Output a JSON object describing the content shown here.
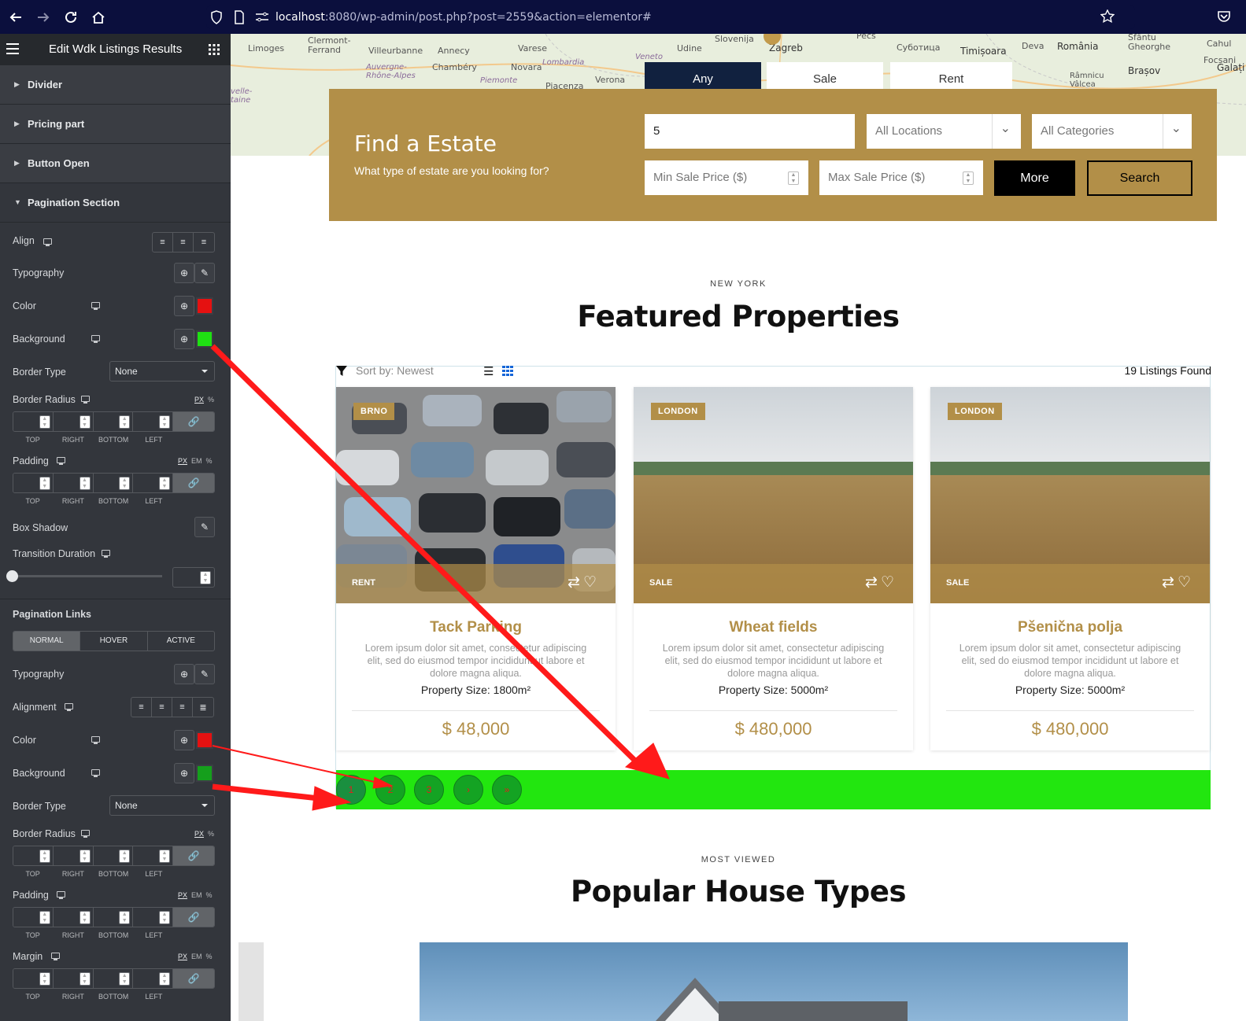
{
  "browser": {
    "url_host": "localhost",
    "url_rest": ":8080/wp-admin/post.php?post=2559&action=elementor#"
  },
  "sidebar": {
    "title": "Edit Wdk Listings Results",
    "sections": [
      "Divider",
      "Pricing part",
      "Button Open",
      "Pagination Section"
    ],
    "pagination_section": {
      "align": "Align",
      "typography": "Typography",
      "color": "Color",
      "color_value": "#e51111",
      "background": "Background",
      "background_value": "#1fe013",
      "border_type": "Border Type",
      "border_type_value": "None",
      "border_radius": "Border Radius",
      "padding": "Padding",
      "box_shadow": "Box Shadow",
      "transition_duration": "Transition Duration"
    },
    "dim_labels": [
      "TOP",
      "RIGHT",
      "BOTTOM",
      "LEFT"
    ],
    "units_px": "PX",
    "units_em": "EM",
    "units_pct": "%",
    "pagination_links": {
      "heading": "Pagination Links",
      "tabs": [
        "NORMAL",
        "HOVER",
        "ACTIVE"
      ],
      "typography": "Typography",
      "alignment": "Alignment",
      "color": "Color",
      "color_value": "#e51111",
      "background": "Background",
      "background_value": "#159f1c",
      "border_type": "Border Type",
      "border_type_value": "None",
      "border_radius": "Border Radius",
      "padding": "Padding",
      "margin": "Margin"
    }
  },
  "map_labels": [
    "Slovenija",
    "Zagreb",
    "Pecs",
    "Суботица",
    "Timișoara",
    "Deva",
    "România",
    "Sfântu Gheorghe",
    "Cahul",
    "Focșani",
    "Galați",
    "Brașov",
    "Râmnicu Vâlcea",
    "Limoges",
    "Clermont-Ferrand",
    "Villeurbanne",
    "Annecy",
    "Varese",
    "Udine",
    "Chambéry",
    "Auvergne-Rhône-Alpes",
    "Novara",
    "Lombardia",
    "Veneto",
    "Verona",
    "Piemonte",
    "Piacenza",
    "velle-taine"
  ],
  "search": {
    "tabs": [
      "Any",
      "Sale",
      "Rent"
    ],
    "heading": "Find a Estate",
    "subheading": "What type of estate are you looking for?",
    "keyword_value": "5",
    "locations_placeholder": "All Locations",
    "categories_placeholder": "All Categories",
    "min_price_placeholder": "Min Sale Price  ($)",
    "max_price_placeholder": "Max Sale Price  ($)",
    "more_label": "More",
    "search_label": "Search"
  },
  "featured": {
    "eyebrow": "NEW YORK",
    "title": "Featured Properties",
    "sort_label": "Sort by: Newest",
    "count": "19 Listings Found",
    "cards": [
      {
        "badge": "BRNO",
        "type": "RENT",
        "title": "Tack Parking",
        "desc": "Lorem ipsum dolor sit amet, consectetur adipiscing elit, sed do eiusmod tempor incididunt ut labore et dolore magna aliqua.",
        "size": "Property Size: 1800m²",
        "price": "$ 48,000"
      },
      {
        "badge": "LONDON",
        "type": "SALE",
        "title": "Wheat fields",
        "desc": "Lorem ipsum dolor sit amet, consectetur adipiscing elit, sed do eiusmod tempor incididunt ut labore et dolore magna aliqua.",
        "size": "Property Size: 5000m²",
        "price": "$ 480,000"
      },
      {
        "badge": "LONDON",
        "type": "SALE",
        "title": "Pšenična polja",
        "desc": "Lorem ipsum dolor sit amet, consectetur adipiscing elit, sed do eiusmod tempor incididunt ut labore et dolore magna aliqua.",
        "size": "Property Size: 5000m²",
        "price": "$ 480,000"
      }
    ],
    "pages": [
      "1",
      "2",
      "3",
      "›",
      "»"
    ]
  },
  "popular": {
    "eyebrow": "MOST VIEWED",
    "title": "Popular House Types"
  },
  "colors": {
    "accent_gold": "#b28f48",
    "navy": "#11213f",
    "pagination_bg": "#22e60f",
    "link_bg": "#14a323",
    "link_color": "#e61c1c",
    "annotation_arrow": "#ff1a1a"
  }
}
